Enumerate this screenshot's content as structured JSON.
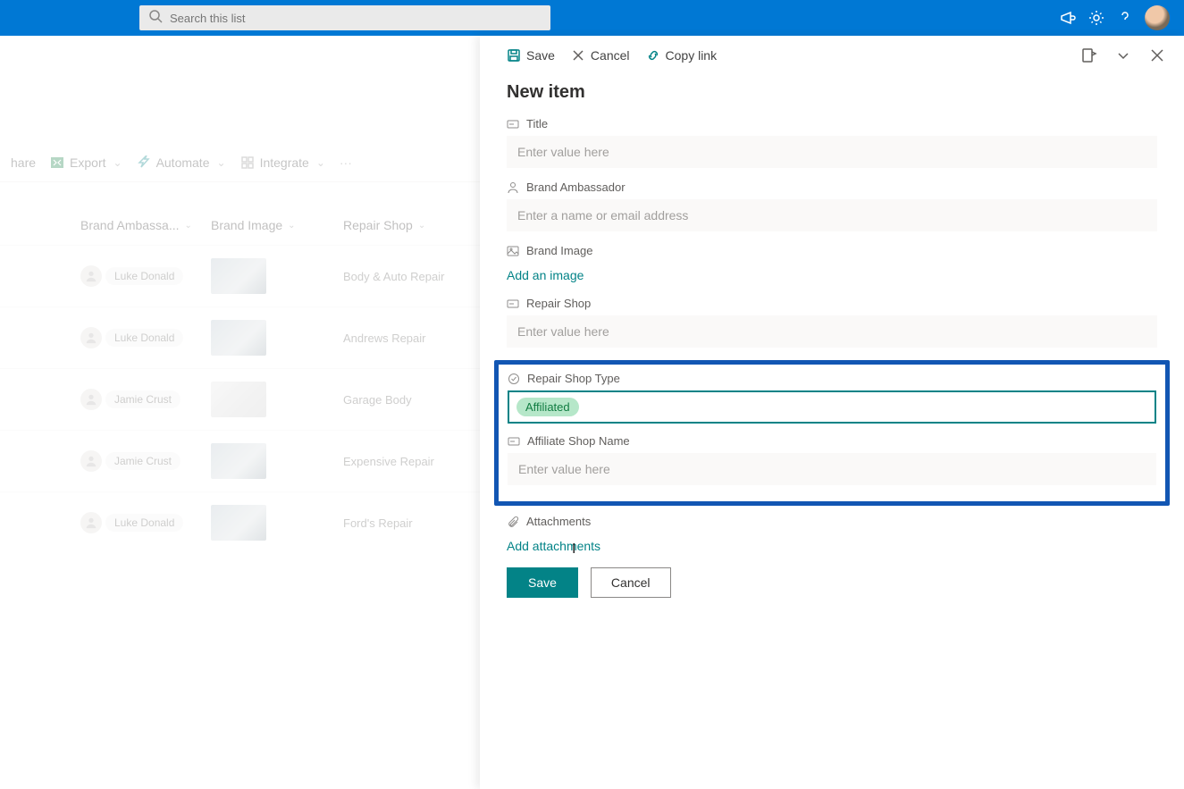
{
  "colors": {
    "accent": "#0078d4",
    "teal": "#038387",
    "highlight_border": "#1256b3"
  },
  "header": {
    "search_placeholder": "Search this list"
  },
  "command_bar": {
    "share": "hare",
    "export": "Export",
    "automate": "Automate",
    "integrate": "Integrate"
  },
  "list": {
    "columns": {
      "brand_ambassador": "Brand Ambassa...",
      "brand_image": "Brand Image",
      "repair_shop": "Repair Shop"
    },
    "rows": [
      {
        "person": "Luke Donald",
        "shop": "Body & Auto Repair"
      },
      {
        "person": "Luke Donald",
        "shop": "Andrews Repair"
      },
      {
        "person": "Jamie Crust",
        "shop": "Garage Body"
      },
      {
        "person": "Jamie Crust",
        "shop": "Expensive Repair"
      },
      {
        "person": "Luke Donald",
        "shop": "Ford's Repair"
      }
    ]
  },
  "panel": {
    "toolbar": {
      "save": "Save",
      "cancel": "Cancel",
      "copy_link": "Copy link"
    },
    "title": "New item",
    "fields": {
      "title": {
        "label": "Title",
        "placeholder": "Enter value here"
      },
      "brand_ambassador": {
        "label": "Brand Ambassador",
        "placeholder": "Enter a name or email address"
      },
      "brand_image": {
        "label": "Brand Image",
        "link": "Add an image"
      },
      "repair_shop": {
        "label": "Repair Shop",
        "placeholder": "Enter value here"
      },
      "repair_shop_type": {
        "label": "Repair Shop Type",
        "selected": "Affiliated"
      },
      "affiliate_shop_name": {
        "label": "Affiliate Shop Name",
        "placeholder": "Enter value here"
      },
      "attachments": {
        "label": "Attachments",
        "link": "Add attachments"
      }
    },
    "actions": {
      "save": "Save",
      "cancel": "Cancel"
    }
  }
}
